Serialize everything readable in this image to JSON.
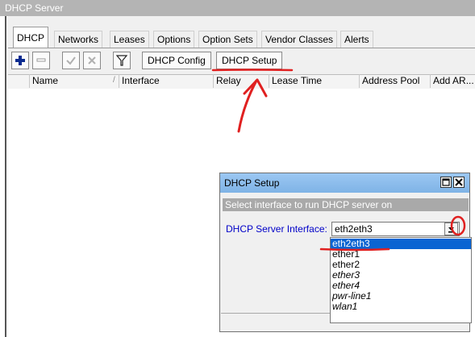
{
  "window": {
    "title": "DHCP Server"
  },
  "tabs": [
    "DHCP",
    "Networks",
    "Leases",
    "Options",
    "Option Sets",
    "Vendor Classes",
    "Alerts"
  ],
  "toolbar": {
    "icons": [
      "plus-icon",
      "minus-icon",
      "check-icon",
      "cross-icon",
      "filter-icon"
    ],
    "dhcp_config_label": "DHCP Config",
    "dhcp_setup_label": "DHCP Setup"
  },
  "table": {
    "columns": [
      "Name",
      "Interface",
      "Relay",
      "Lease Time",
      "Address Pool",
      "Add AR..."
    ]
  },
  "dialog": {
    "title": "DHCP Setup",
    "instruction": "Select interface to run DHCP server on",
    "interface_label": "DHCP Server Interface:",
    "interface_value": "eth2eth3",
    "options": [
      "eth2eth3",
      "ether1",
      "ether2",
      "ether3",
      "ether4",
      "pwr-line1",
      "wlan1"
    ],
    "italic_options": [
      "ether3",
      "ether4",
      "pwr-line1",
      "wlan1"
    ]
  },
  "colors": {
    "title_bar": "#b4b4b4",
    "dialog_title": "#8dbdee",
    "selection": "#0a64d2",
    "annotation": "#e02020",
    "label_blue": "#0000c8"
  }
}
